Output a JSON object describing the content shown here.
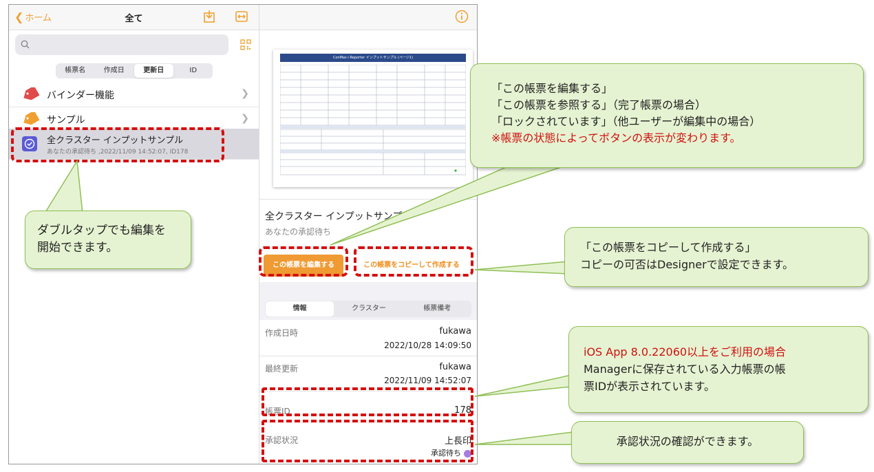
{
  "nav": {
    "back_label": "ホーム",
    "title": "全て"
  },
  "search": {
    "placeholder": ""
  },
  "sort_tabs": [
    "帳票名",
    "作成日",
    "更新日",
    "ID"
  ],
  "sort_active_index": 2,
  "list": {
    "items": [
      {
        "label": "バインダー機能",
        "tag_color": "#e04a4a"
      },
      {
        "label": "サンプル",
        "tag_color": "#f0a030"
      }
    ],
    "selected": {
      "label": "全クラスター インプットサンプル",
      "sub": "あなたの承認待ち ,2022/11/09 14:52:07, ID178"
    }
  },
  "preview": {
    "header_text": "ConMas i-Reporter インプットサンプル (ページ1)"
  },
  "document": {
    "title": "全クラスター インプットサンプル",
    "status": "あなたの承認待ち",
    "edit_button": "この帳票を編集する",
    "copy_button": "この帳票をコピーして作成する"
  },
  "info_tabs": [
    "情報",
    "クラスター",
    "帳票備考"
  ],
  "info_active_index": 0,
  "info": {
    "created_label": "作成日時",
    "created_user": "fukawa",
    "created_date": "2022/10/28 14:09:50",
    "updated_label": "最終更新",
    "updated_user": "fukawa",
    "updated_date": "2022/11/09 14:52:07",
    "id_label": "帳票ID",
    "id_value": "178",
    "approval_label": "承認状況",
    "approval_role": "上長印",
    "approval_state": "承認待ち"
  },
  "callouts": {
    "buttons": {
      "line1": "「この帳票を編集する」",
      "line2": "「この帳票を参照する」（完了帳票の場合）",
      "line3": "「ロックされています」（他ユーザーが編集中の場合）",
      "note": "※帳票の状態によってボタンの表示が変わります。"
    },
    "double_tap": {
      "line1": "ダブルタップでも編集を",
      "line2": "開始できます。"
    },
    "copy": {
      "line1": "「この帳票をコピーして作成する」",
      "line2": "コピーの可否はDesignerで設定できます。"
    },
    "id": {
      "line1": "iOS App 8.0.22060以上をご利用の場合",
      "line2": "Managerに保存されている入力帳票の帳",
      "line3": "票IDが表示されています。"
    },
    "approval": {
      "line1": "承認状況の確認ができます。"
    }
  },
  "colors": {
    "accent": "#ef9a33",
    "highlight": "#d41010",
    "callout_bg": "#e6f3d2",
    "callout_border": "#8fbf55"
  }
}
